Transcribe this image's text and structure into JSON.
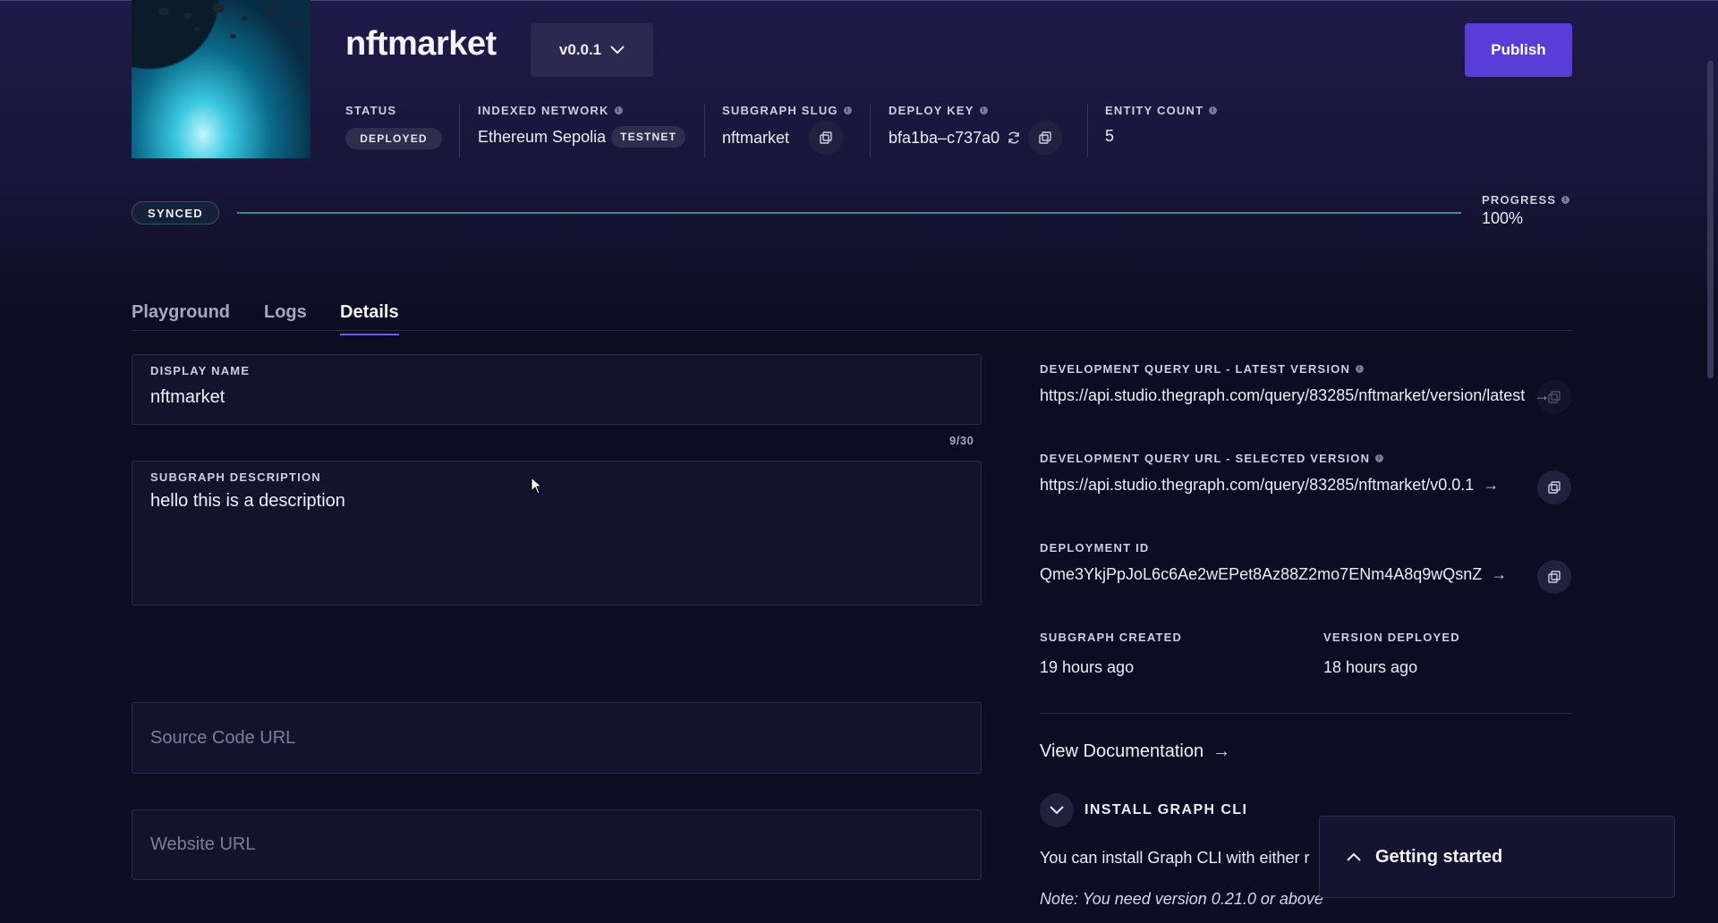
{
  "header": {
    "title": "nftmarket",
    "version_label": "v0.0.1",
    "publish_label": "Publish"
  },
  "meta": {
    "status": {
      "label": "STATUS",
      "value": "DEPLOYED"
    },
    "network": {
      "label": "INDEXED NETWORK",
      "value": "Ethereum Sepolia",
      "tag": "TESTNET"
    },
    "slug": {
      "label": "SUBGRAPH SLUG",
      "value": "nftmarket"
    },
    "deploy_key": {
      "label": "DEPLOY KEY",
      "value": "bfa1ba–c737a0"
    },
    "entity_count": {
      "label": "ENTITY COUNT",
      "value": "5"
    }
  },
  "sync": {
    "badge": "SYNCED",
    "progress_label": "PROGRESS",
    "progress_value": "100%",
    "progress_fraction": 1.0,
    "bar_color": "#3bb0a3"
  },
  "tabs": [
    {
      "label": "Playground"
    },
    {
      "label": "Logs"
    },
    {
      "label": "Details",
      "active": true
    }
  ],
  "form": {
    "display_name": {
      "label": "DISPLAY NAME",
      "value": "nftmarket",
      "counter": "9/30"
    },
    "description": {
      "label": "SUBGRAPH DESCRIPTION",
      "value": "hello this is a description"
    },
    "source_code": {
      "placeholder": "Source Code URL"
    },
    "website": {
      "placeholder": "Website URL"
    }
  },
  "details": {
    "latest_url": {
      "label": "DEVELOPMENT QUERY URL - LATEST VERSION",
      "value": "https://api.studio.thegraph.com/query/83285/nftmarket/version/latest"
    },
    "selected_url": {
      "label": "DEVELOPMENT QUERY URL - SELECTED VERSION",
      "value": "https://api.studio.thegraph.com/query/83285/nftmarket/v0.0.1"
    },
    "deployment_id": {
      "label": "DEPLOYMENT ID",
      "value": "Qme3YkjPpJoL6c6Ae2wEPet8Az88Z2mo7ENm4A8q9wQsnZ"
    },
    "created": {
      "label": "SUBGRAPH CREATED",
      "value": "19 hours ago"
    },
    "deployed": {
      "label": "VERSION DEPLOYED",
      "value": "18 hours ago"
    },
    "docs_link": "View Documentation",
    "install_cli": {
      "label": "INSTALL GRAPH CLI",
      "text": "You can install Graph CLI with either r",
      "note": "Note: You need version 0.21.0 or above"
    }
  },
  "toast": {
    "label": "Getting started"
  },
  "colors": {
    "accent": "#5a3cd8",
    "tab_underline": "#6d5af0",
    "background": "#0e0c22"
  }
}
